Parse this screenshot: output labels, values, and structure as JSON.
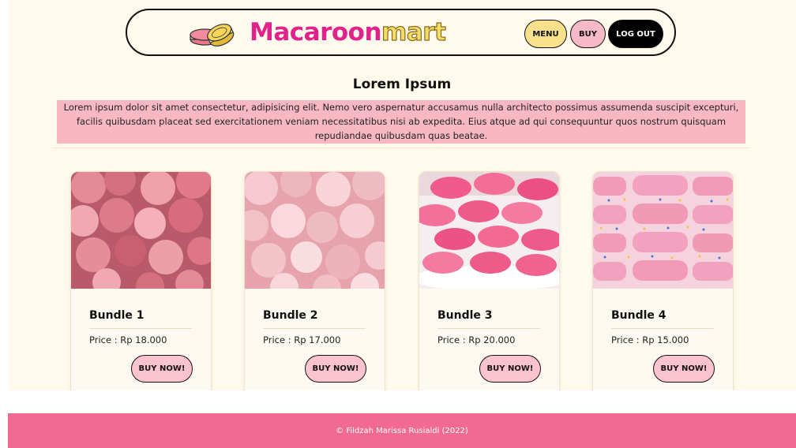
{
  "header": {
    "brand_part1": "Macaroon",
    "brand_part2": "mart",
    "nav": {
      "menu_label": "MENU",
      "buy_label": "BUY",
      "logout_label": "LOG OUT"
    },
    "logo_icon": "macaron-icon"
  },
  "intro": {
    "title": "Lorem Ipsum",
    "text": "Lorem ipsum dolor sit amet consectetur, adipisicing elit. Nemo vero aspernatur accusamus nulla architecto possimus assumenda suscipit excepturi, facilis quibusdam placeat sed exercitationem veniam necessitatibus nisi ab expedita. Eius atque ad qui consequuntur quos nostrum quisquam repudiandae quibusdam quas beatae."
  },
  "products": [
    {
      "title": "Bundle 1",
      "price": "Price : Rp 18.000",
      "button": "BUY NOW!",
      "image": "pink-macarons-photo"
    },
    {
      "title": "Bundle 2",
      "price": "Price : Rp 17.000",
      "button": "BUY NOW!",
      "image": "pale-pink-macarons-photo"
    },
    {
      "title": "Bundle 3",
      "price": "Price : Rp 20.000",
      "button": "BUY NOW!",
      "image": "macaron-stack-photo"
    },
    {
      "title": "Bundle 4",
      "price": "Price : Rp 15.000",
      "button": "BUY NOW!",
      "image": "sprinkle-macarons-photo"
    }
  ],
  "footer": {
    "text": "© Fildzah Marissa Rusialdi (2022)"
  },
  "colors": {
    "background": "#fffaeb",
    "brand_pink": "#e0228a",
    "brand_yellow": "#f3dd6a",
    "intro_bg": "#f7b8c4",
    "footer_bg": "#f06a93",
    "menu_btn": "#f9e08a",
    "buy_btn": "#f7b9c8"
  }
}
